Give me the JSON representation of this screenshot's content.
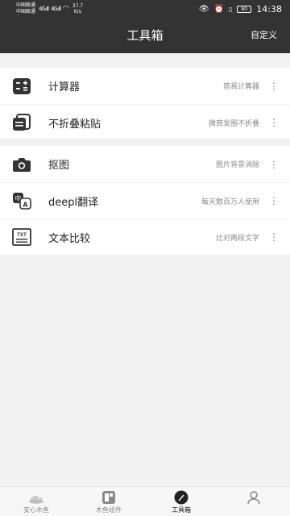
{
  "status_bar": {
    "carrier1": "中国联通",
    "carrier2": "中国联通",
    "signal1": "4G.ıll",
    "signal2": "4G.ıll",
    "speed_value": "37.7",
    "speed_unit": "K/s",
    "battery": "80",
    "time": "14:38"
  },
  "header": {
    "title": "工具箱",
    "action_label": "自定义"
  },
  "groups": [
    {
      "items": [
        {
          "label": "计算器",
          "desc": "简易计算器",
          "icon": "calculator-icon"
        },
        {
          "label": "不折叠粘贴",
          "desc": "微商发圈不折叠",
          "icon": "paste-icon"
        }
      ]
    },
    {
      "items": [
        {
          "label": "抠图",
          "desc": "图片背景消除",
          "icon": "camera-icon"
        },
        {
          "label": "deepl翻译",
          "desc": "每天数百万人使用",
          "icon": "translate-icon"
        },
        {
          "label": "文本比较",
          "desc": "比对两段文字",
          "icon": "text-compare-icon"
        }
      ]
    }
  ],
  "tabs": [
    {
      "label": "安心木鱼",
      "icon": "fish-icon",
      "active": false
    },
    {
      "label": "木鱼组件",
      "icon": "widget-icon",
      "active": false
    },
    {
      "label": "工具箱",
      "icon": "toolbox-icon",
      "active": true
    },
    {
      "label": "",
      "icon": "profile-icon",
      "active": false
    }
  ],
  "colors": {
    "header_bg": "#333333",
    "page_bg": "#f2f2f2",
    "card_bg": "#ffffff",
    "text_primary": "#222222",
    "text_secondary": "#888888"
  }
}
